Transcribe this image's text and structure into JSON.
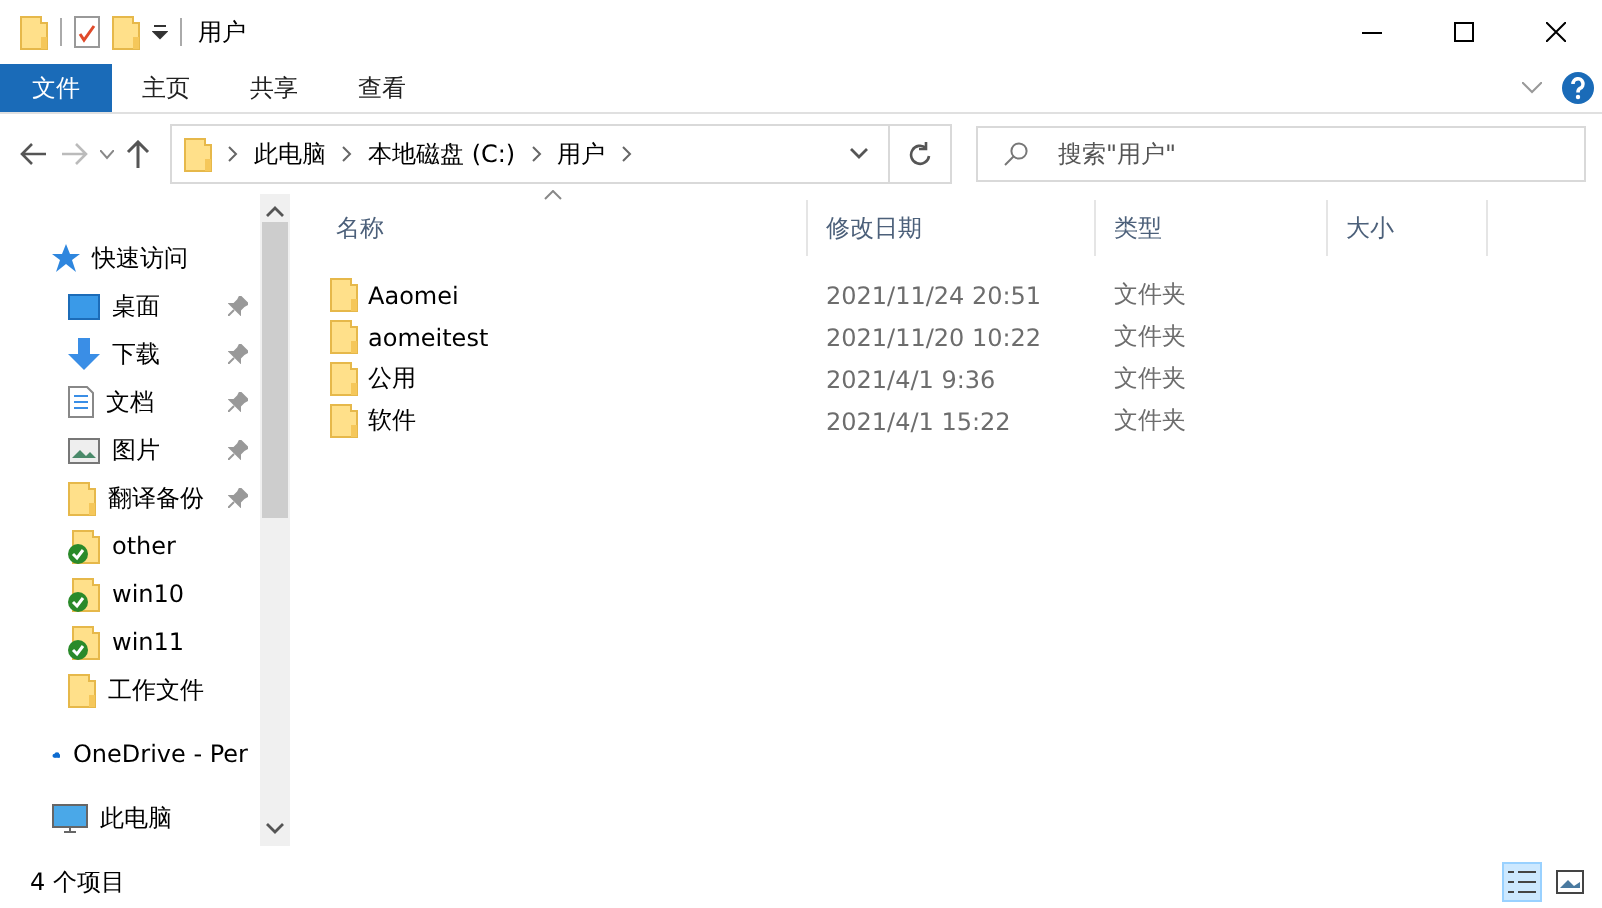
{
  "window": {
    "title": "用户"
  },
  "ribbon_tabs": [
    {
      "label": "文件",
      "selected": true
    },
    {
      "label": "主页",
      "selected": false
    },
    {
      "label": "共享",
      "selected": false
    },
    {
      "label": "查看",
      "selected": false
    }
  ],
  "address": {
    "path": [
      "此电脑",
      "本地磁盘 (C:)",
      "用户"
    ]
  },
  "search": {
    "placeholder": "搜索\"用户\""
  },
  "sidebar": {
    "items": [
      {
        "kind": "star",
        "label": "快速访问",
        "pinned": false
      },
      {
        "kind": "desktop",
        "label": "桌面",
        "pinned": true
      },
      {
        "kind": "download",
        "label": "下载",
        "pinned": true
      },
      {
        "kind": "document",
        "label": "文档",
        "pinned": true
      },
      {
        "kind": "picture",
        "label": "图片",
        "pinned": true
      },
      {
        "kind": "folder",
        "label": "翻译备份",
        "pinned": true
      },
      {
        "kind": "synced",
        "label": "other",
        "pinned": false
      },
      {
        "kind": "synced",
        "label": "win10",
        "pinned": false
      },
      {
        "kind": "synced",
        "label": "win11",
        "pinned": false
      },
      {
        "kind": "folder",
        "label": "工作文件",
        "pinned": false
      },
      {
        "kind": "cloud",
        "label": "OneDrive - Per",
        "pinned": false
      },
      {
        "kind": "pc",
        "label": "此电脑",
        "pinned": false
      }
    ]
  },
  "table": {
    "columns": [
      "名称",
      "修改日期",
      "类型",
      "大小"
    ],
    "rows": [
      {
        "name": "Aaomei",
        "modified": "2021/11/24 20:51",
        "type": "文件夹"
      },
      {
        "name": "aomeitest",
        "modified": "2021/11/20 10:22",
        "type": "文件夹"
      },
      {
        "name": "公用",
        "modified": "2021/4/1 9:36",
        "type": "文件夹"
      },
      {
        "name": "软件",
        "modified": "2021/4/1 15:22",
        "type": "文件夹"
      }
    ]
  },
  "status_bar": {
    "count": "4 个项目",
    "views": [
      {
        "kind": "details",
        "selected": true
      },
      {
        "kind": "large-icons",
        "selected": false
      }
    ]
  }
}
